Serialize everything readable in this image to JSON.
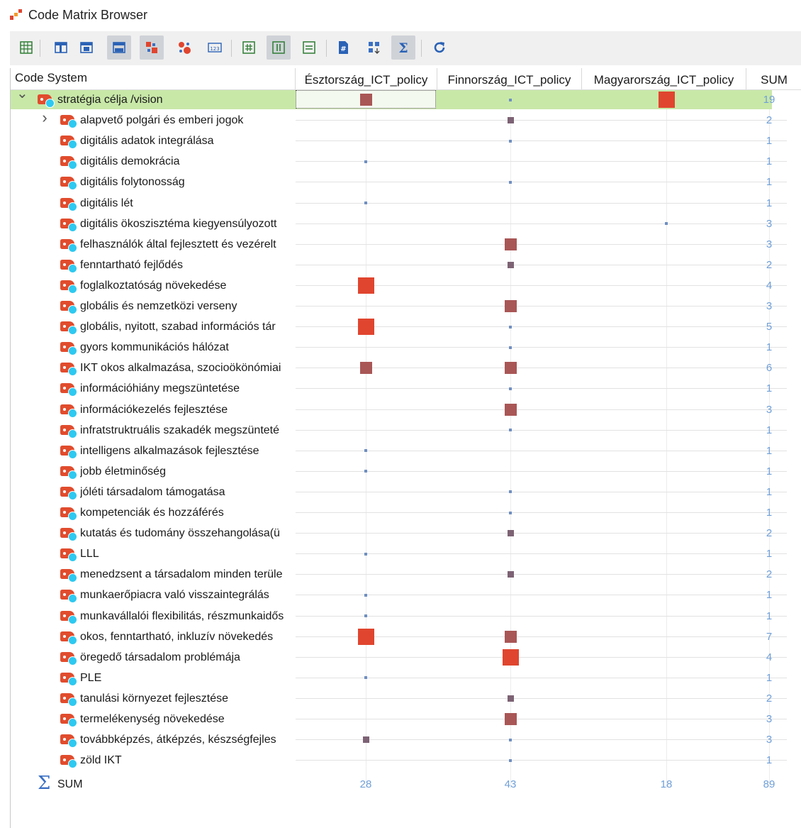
{
  "window": {
    "title": "Code Matrix Browser"
  },
  "toolbar": {
    "buttons": [
      {
        "icon": "grid-icon",
        "active": false
      },
      {
        "icon": "layout-top-icon",
        "active": false
      },
      {
        "icon": "layout-middle-icon",
        "active": false
      },
      {
        "icon": "layout-bottom-icon",
        "active": true
      },
      {
        "icon": "squares-symbol-icon",
        "active": true
      },
      {
        "icon": "circles-symbol-icon",
        "active": false
      },
      {
        "icon": "numbers-123-icon",
        "active": false
      },
      {
        "icon": "hash-grid-icon",
        "active": false
      },
      {
        "icon": "columns-icon",
        "active": true
      },
      {
        "icon": "rows-icon",
        "active": false
      },
      {
        "icon": "hash-document-icon",
        "active": false
      },
      {
        "icon": "matrix-sort-icon",
        "active": false
      },
      {
        "icon": "sigma-icon",
        "active": true
      },
      {
        "icon": "refresh-icon",
        "active": false
      }
    ]
  },
  "columns": {
    "code_system": "Code System",
    "docs": [
      "Észtország_ICT_policy",
      "Finnország_ICT_policy",
      "Magyarország_ICT_policy"
    ],
    "sum": "SUM"
  },
  "colors": {
    "small": "#7d6274",
    "medium": "#a95656",
    "large": "#e0452f",
    "sum_text": "#6f9fd8",
    "selection": "#c8e8a8"
  },
  "root": {
    "label": "stratégia célja /vision",
    "values": [
      2,
      1,
      3
    ],
    "sum": "19"
  },
  "codes": [
    {
      "label": "alapvető polgári és emberi jogok",
      "values": [
        0,
        2,
        0
      ],
      "sum": "2",
      "expandable": true
    },
    {
      "label": "digitális adatok integrálása",
      "values": [
        0,
        1,
        0
      ],
      "sum": "1"
    },
    {
      "label": "digitális demokrácia",
      "values": [
        1,
        0,
        0
      ],
      "sum": "1"
    },
    {
      "label": "digitális folytonosság",
      "values": [
        0,
        1,
        0
      ],
      "sum": "1"
    },
    {
      "label": "digitális lét",
      "values": [
        1,
        0,
        0
      ],
      "sum": "1"
    },
    {
      "label": "digitális ökoszisztéma kiegyensúlyozott",
      "values": [
        0,
        0,
        1
      ],
      "sum": "3"
    },
    {
      "label": "felhasználók által fejlesztett és vezérelt",
      "values": [
        0,
        3,
        0
      ],
      "sum": "3"
    },
    {
      "label": "fenntartható fejlődés",
      "values": [
        0,
        2,
        0
      ],
      "sum": "2"
    },
    {
      "label": "foglalkoztatóság növekedése",
      "values": [
        4,
        0,
        0
      ],
      "sum": "4"
    },
    {
      "label": "globális és nemzetközi verseny",
      "values": [
        0,
        3,
        0
      ],
      "sum": "3"
    },
    {
      "label": "globális, nyitott, szabad információs tár",
      "values": [
        4,
        1,
        0
      ],
      "sum": "5"
    },
    {
      "label": "gyors kommunikációs hálózat",
      "values": [
        0,
        1,
        0
      ],
      "sum": "1"
    },
    {
      "label": "IKT okos alkalmazása, szocioökönómiai",
      "values": [
        3,
        3,
        0
      ],
      "sum": "6"
    },
    {
      "label": "információhiány megszüntetése",
      "values": [
        0,
        1,
        0
      ],
      "sum": "1"
    },
    {
      "label": "információkezelés fejlesztése",
      "values": [
        0,
        3,
        0
      ],
      "sum": "3"
    },
    {
      "label": "infratstruktruális szakadék megszünteté",
      "values": [
        0,
        1,
        0
      ],
      "sum": "1"
    },
    {
      "label": "intelligens alkalmazások fejlesztése",
      "values": [
        1,
        0,
        0
      ],
      "sum": "1"
    },
    {
      "label": "jobb életminőség",
      "values": [
        1,
        0,
        0
      ],
      "sum": "1"
    },
    {
      "label": "jóléti társadalom támogatása",
      "values": [
        0,
        1,
        0
      ],
      "sum": "1"
    },
    {
      "label": "kompetenciák és hozzáférés",
      "values": [
        0,
        1,
        0
      ],
      "sum": "1"
    },
    {
      "label": "kutatás és tudomány összehangolása(ü",
      "values": [
        0,
        2,
        0
      ],
      "sum": "2"
    },
    {
      "label": "LLL",
      "values": [
        1,
        0,
        0
      ],
      "sum": "1"
    },
    {
      "label": "menedzsent a társadalom minden terüle",
      "values": [
        0,
        2,
        0
      ],
      "sum": "2"
    },
    {
      "label": "munkaerőpiacra való visszaintegrálás",
      "values": [
        1,
        0,
        0
      ],
      "sum": "1"
    },
    {
      "label": "munkavállalói flexibilitás, részmunkaidős",
      "values": [
        1,
        0,
        0
      ],
      "sum": "1"
    },
    {
      "label": "okos, fenntartható, inkluzív növekedés",
      "values": [
        4,
        3,
        0
      ],
      "sum": "7"
    },
    {
      "label": "öregedő társadalom problémája",
      "values": [
        0,
        4,
        0
      ],
      "sum": "4"
    },
    {
      "label": "PLE",
      "values": [
        1,
        0,
        0
      ],
      "sum": "1"
    },
    {
      "label": "tanulási környezet fejlesztése",
      "values": [
        0,
        2,
        0
      ],
      "sum": "2"
    },
    {
      "label": "termelékenység növekedése",
      "values": [
        0,
        3,
        0
      ],
      "sum": "3"
    },
    {
      "label": "továbbképzés, átképzés, készségfejles",
      "values": [
        2,
        1,
        0
      ],
      "sum": "3"
    },
    {
      "label": "zöld IKT",
      "values": [
        0,
        1,
        0
      ],
      "sum": "1"
    }
  ],
  "sum_row": {
    "label": "SUM",
    "values": [
      "28",
      "43",
      "18"
    ],
    "total": "89"
  }
}
